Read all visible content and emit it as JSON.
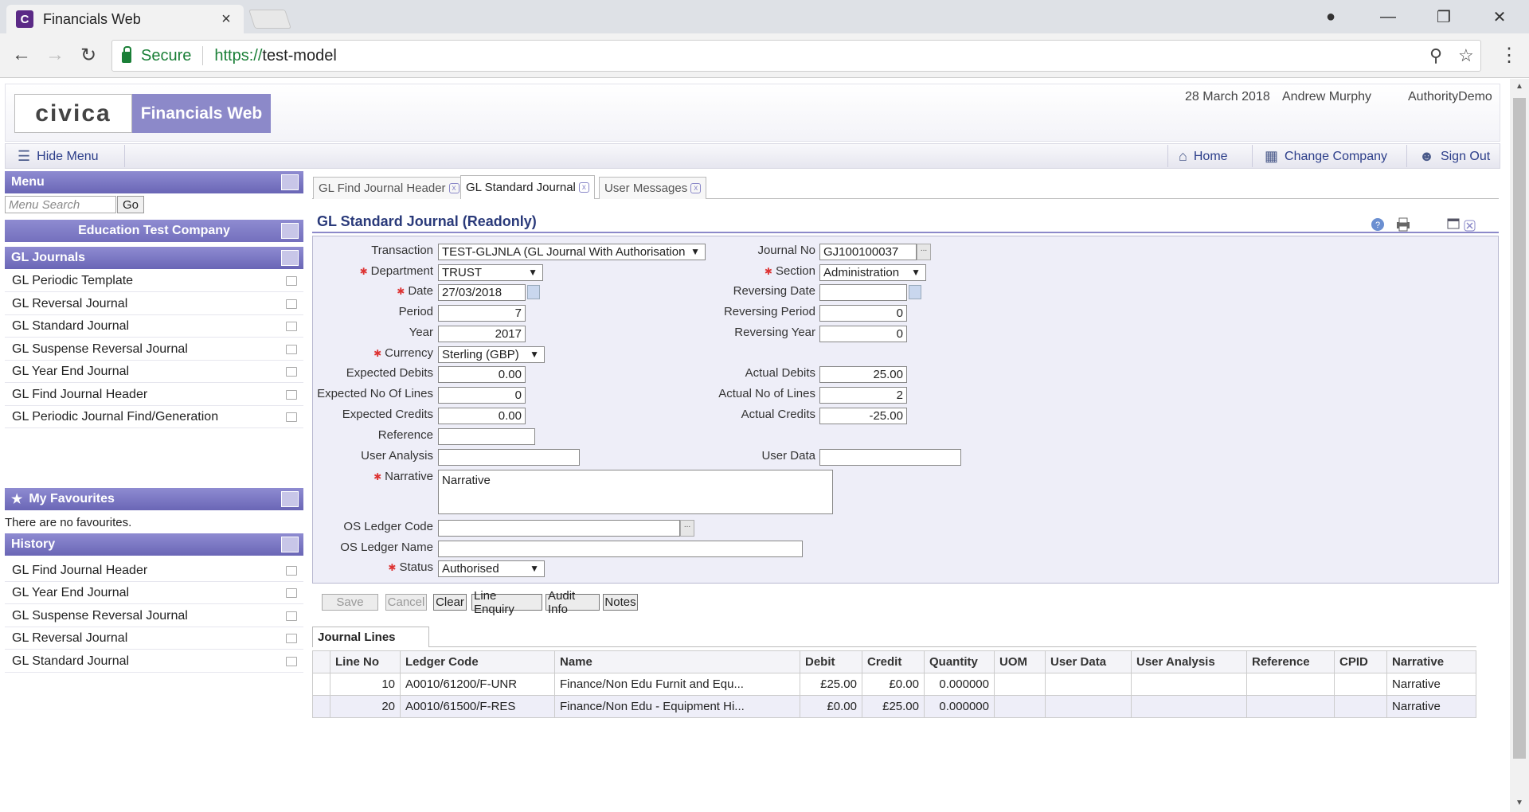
{
  "browser": {
    "tab_title": "Financials Web",
    "favicon_letter": "C",
    "secure_label": "Secure",
    "url_scheme": "https://",
    "url_host": "test-model"
  },
  "header": {
    "logo_text": "civica",
    "product_name": "Financials Web",
    "date": "28 March 2018",
    "user": "Andrew Murphy",
    "authority": "AuthorityDemo"
  },
  "navbar": {
    "hide_menu": "Hide Menu",
    "home": "Home",
    "change_company": "Change Company",
    "sign_out": "Sign Out"
  },
  "sidebar": {
    "menu_title": "Menu",
    "search_placeholder": "Menu Search",
    "go_label": "Go",
    "company": "Education Test Company",
    "section": "GL Journals",
    "items": [
      "GL Periodic Template",
      "GL Reversal Journal",
      "GL Standard Journal",
      "GL Suspense Reversal Journal",
      "GL Year End Journal",
      "GL Find Journal Header",
      "GL Periodic Journal Find/Generation"
    ],
    "favourites_title": "My Favourites",
    "no_favourites": "There are no favourites.",
    "history_title": "History",
    "history": [
      "GL Find Journal Header",
      "GL Year End Journal",
      "GL Suspense Reversal Journal",
      "GL Reversal Journal",
      "GL Standard Journal"
    ]
  },
  "tabs": [
    "GL Find Journal Header",
    "GL Standard Journal",
    "User Messages"
  ],
  "form": {
    "title": "GL Standard Journal (Readonly)",
    "labels": {
      "transaction": "Transaction",
      "department": "Department",
      "date": "Date",
      "period": "Period",
      "year": "Year",
      "currency": "Currency",
      "expected_debits": "Expected Debits",
      "expected_lines": "Expected No Of Lines",
      "expected_credits": "Expected Credits",
      "reference": "Reference",
      "user_analysis": "User Analysis",
      "narrative": "Narrative",
      "os_ledger_code": "OS Ledger Code",
      "os_ledger_name": "OS Ledger Name",
      "status": "Status",
      "journal_no": "Journal No",
      "section": "Section",
      "reversing_date": "Reversing Date",
      "reversing_period": "Reversing Period",
      "reversing_year": "Reversing Year",
      "actual_debits": "Actual Debits",
      "actual_lines": "Actual No of Lines",
      "actual_credits": "Actual Credits",
      "user_data": "User Data"
    },
    "values": {
      "transaction": "TEST-GLJNLA (GL Journal With Authorisation",
      "department": "TRUST",
      "date": "27/03/2018",
      "period": "7",
      "year": "2017",
      "currency": "Sterling (GBP)",
      "expected_debits": "0.00",
      "expected_lines": "0",
      "expected_credits": "0.00",
      "reference": "",
      "user_analysis": "",
      "narrative": "Narrative",
      "os_ledger_code": "",
      "os_ledger_name": "",
      "status": "Authorised",
      "journal_no": "GJ100100037",
      "section": "Administration",
      "reversing_date": "",
      "reversing_period": "0",
      "reversing_year": "0",
      "actual_debits": "25.00",
      "actual_lines": "2",
      "actual_credits": "-25.00",
      "user_data": ""
    }
  },
  "actions": {
    "save": "Save",
    "cancel": "Cancel",
    "clear": "Clear",
    "line_enquiry": "Line Enquiry",
    "audit_info": "Audit Info",
    "notes": "Notes"
  },
  "journal_lines": {
    "tab": "Journal Lines",
    "columns": [
      "Line No",
      "Ledger Code",
      "Name",
      "Debit",
      "Credit",
      "Quantity",
      "UOM",
      "User Data",
      "User Analysis",
      "Reference",
      "CPID",
      "Narrative"
    ],
    "rows": [
      [
        "10",
        "A0010/61200/F-UNR",
        "Finance/Non Edu Furnit and Equ...",
        "£25.00",
        "£0.00",
        "0.000000",
        "",
        "",
        "",
        "",
        "",
        "Narrative"
      ],
      [
        "20",
        "A0010/61500/F-RES",
        "Finance/Non Edu - Equipment Hi...",
        "£0.00",
        "£25.00",
        "0.000000",
        "",
        "",
        "",
        "",
        "",
        "Narrative"
      ]
    ]
  }
}
